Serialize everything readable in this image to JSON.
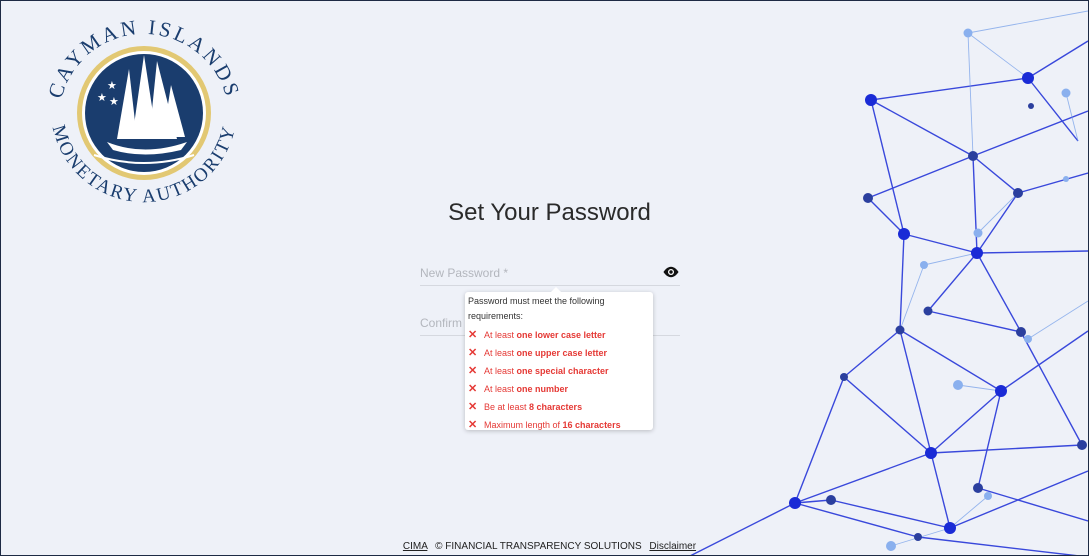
{
  "logo": {
    "top_text": "CAYMAN ISLANDS",
    "bottom_text": "MONETARY AUTHORITY",
    "icon": "ship-seal-icon"
  },
  "form": {
    "title": "Set Your Password",
    "new_password_placeholder": "New Password *",
    "confirm_password_placeholder": "Confirm",
    "toggle_visibility_icon": "eye-icon"
  },
  "requirements": {
    "heading": "Password must meet the following requirements:",
    "items": [
      {
        "prefix": "At least ",
        "bold": "one lower case letter",
        "suffix": ""
      },
      {
        "prefix": "At least ",
        "bold": "one upper case letter",
        "suffix": ""
      },
      {
        "prefix": "At least ",
        "bold": "one special character",
        "suffix": ""
      },
      {
        "prefix": "At least ",
        "bold": "one number",
        "suffix": ""
      },
      {
        "prefix": "Be at least ",
        "bold": "8 characters",
        "suffix": ""
      },
      {
        "prefix": "Maximum length of ",
        "bold": "16 characters",
        "suffix": ""
      }
    ],
    "status_icon": "x-mark-icon",
    "status_color": "#e53935"
  },
  "footer": {
    "cima_link": "CIMA",
    "copyright": "© FINANCIAL TRANSPARENCY SOLUTIONS",
    "disclaimer_link": "Disclaimer"
  },
  "colors": {
    "background": "#eef1f8",
    "brand_navy": "#1a3d6e",
    "network_blue": "#1a2bd6"
  }
}
